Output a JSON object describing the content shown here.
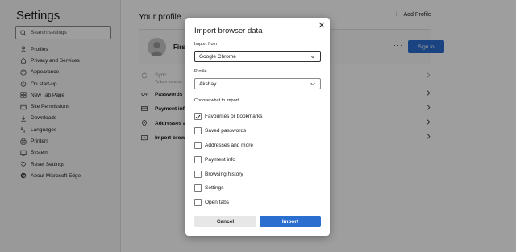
{
  "sidebar": {
    "title": "Settings",
    "search_placeholder": "Search settings",
    "items": [
      {
        "label": "Profiles",
        "icon": "person-icon"
      },
      {
        "label": "Privacy and Services",
        "icon": "lock-icon"
      },
      {
        "label": "Appearance",
        "icon": "palette-icon"
      },
      {
        "label": "On start-up",
        "icon": "power-icon"
      },
      {
        "label": "New Tab Page",
        "icon": "grid-icon"
      },
      {
        "label": "Site Permissions",
        "icon": "site-permissions-icon"
      },
      {
        "label": "Downloads",
        "icon": "download-icon"
      },
      {
        "label": "Languages",
        "icon": "languages-icon"
      },
      {
        "label": "Printers",
        "icon": "printer-icon"
      },
      {
        "label": "System",
        "icon": "computer-icon"
      },
      {
        "label": "Reset Settings",
        "icon": "reset-icon"
      },
      {
        "label": "About Microsoft Edge",
        "icon": "edge-icon"
      }
    ]
  },
  "main": {
    "title": "Your profile",
    "add_profile": "Add Profile",
    "profile_name": "First",
    "sign_in": "Sign In",
    "rows": [
      {
        "label": "Sync",
        "sub": "To turn on sync",
        "icon": "sync-icon"
      },
      {
        "label": "Passwords",
        "icon": "key-icon"
      },
      {
        "label": "Payment info",
        "icon": "card-icon"
      },
      {
        "label": "Addresses and",
        "icon": "location-icon"
      },
      {
        "label": "Import brows",
        "icon": "import-icon"
      }
    ]
  },
  "dialog": {
    "title": "Import browser data",
    "import_from_label": "Import from",
    "import_from_value": "Google Chrome",
    "profile_label": "Profile",
    "profile_value": "Akshay",
    "choose_label": "Choose what to import",
    "options": [
      {
        "label": "Favourites or bookmarks",
        "checked": true
      },
      {
        "label": "Saved passwords",
        "checked": false
      },
      {
        "label": "Addresses and more",
        "checked": false
      },
      {
        "label": "Payment info",
        "checked": false
      },
      {
        "label": "Browsing history",
        "checked": false
      },
      {
        "label": "Settings",
        "checked": false
      },
      {
        "label": "Open tabs",
        "checked": false
      }
    ],
    "cancel": "Cancel",
    "import": "Import"
  },
  "colors": {
    "accent": "#2a6fd0",
    "overlay": "rgba(0,0,0,0.38)"
  }
}
